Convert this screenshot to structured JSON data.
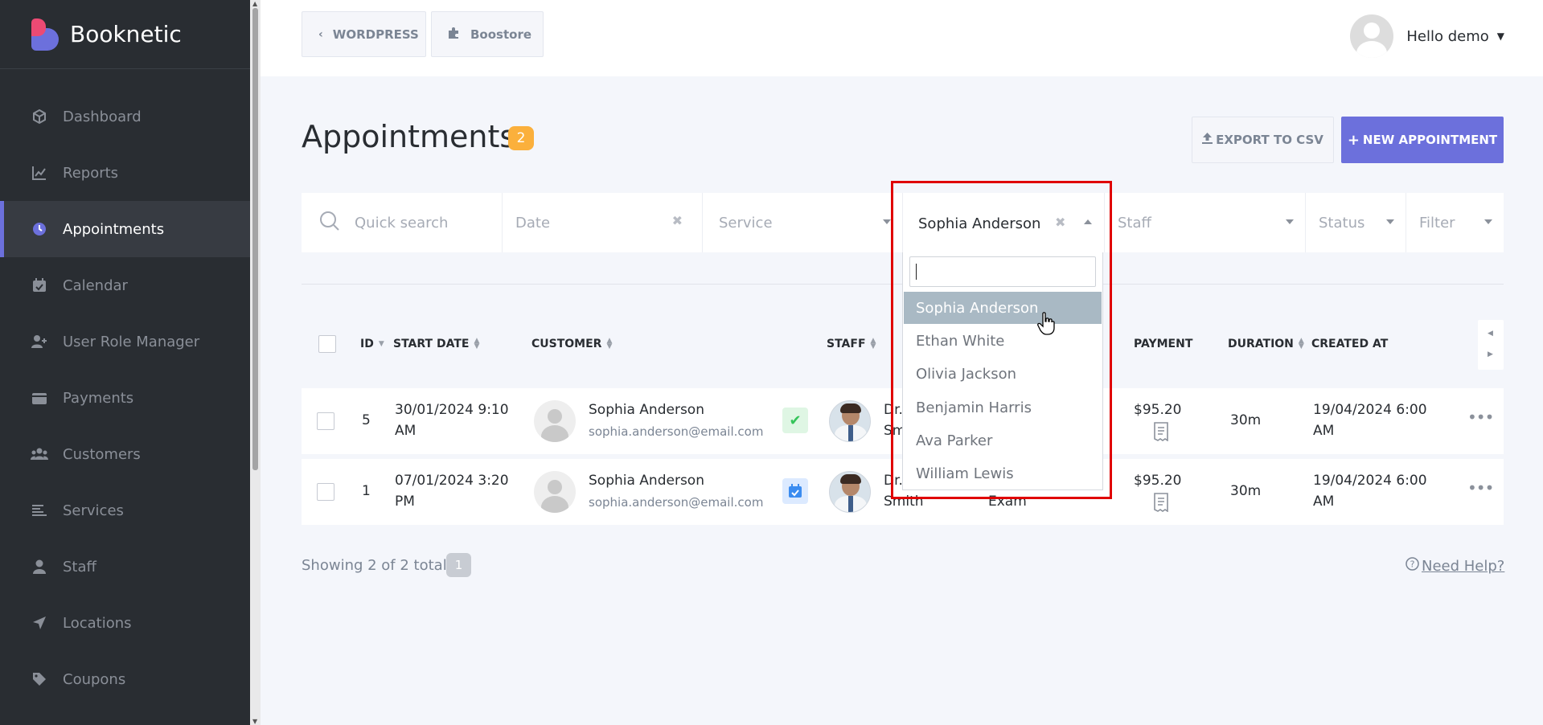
{
  "brand": {
    "name": "Booknetic"
  },
  "sidebar": {
    "items": [
      {
        "label": "Dashboard",
        "icon": "cube-icon"
      },
      {
        "label": "Reports",
        "icon": "chart-icon"
      },
      {
        "label": "Appointments",
        "icon": "clock-icon",
        "active": true
      },
      {
        "label": "Calendar",
        "icon": "calendar-icon"
      },
      {
        "label": "User Role Manager",
        "icon": "user-plus-icon"
      },
      {
        "label": "Payments",
        "icon": "wallet-icon"
      },
      {
        "label": "Customers",
        "icon": "users-icon"
      },
      {
        "label": "Services",
        "icon": "list-icon"
      },
      {
        "label": "Staff",
        "icon": "user-icon"
      },
      {
        "label": "Locations",
        "icon": "location-arrow-icon"
      },
      {
        "label": "Coupons",
        "icon": "tag-icon"
      }
    ]
  },
  "topbar": {
    "wordpress_label": "WORDPRESS",
    "boostore_label": "Boostore",
    "user_greeting": "Hello demo"
  },
  "page": {
    "title": "Appointments",
    "count": "2",
    "export_label": "EXPORT TO CSV",
    "new_label": "NEW APPOINTMENT"
  },
  "filters": {
    "search_placeholder": "Quick search",
    "date_placeholder": "Date",
    "service_placeholder": "Service",
    "customer_selected": "Sophia Anderson",
    "staff_placeholder": "Staff",
    "status_placeholder": "Status",
    "filter_placeholder": "Filter"
  },
  "dropdown": {
    "options": [
      "Sophia Anderson",
      "Ethan White",
      "Olivia Jackson",
      "Benjamin Harris",
      "Ava Parker",
      "William Lewis"
    ],
    "highlighted": "Sophia Anderson"
  },
  "table": {
    "headers": {
      "id": "ID",
      "start_date": "START DATE",
      "customer": "CUSTOMER",
      "staff": "STAFF",
      "payment": "PAYMENT",
      "duration": "DURATION",
      "created_at": "CREATED AT"
    },
    "rows": [
      {
        "id": "5",
        "start_line1": "30/01/2024 9:10",
        "start_line2": "AM",
        "customer_name": "Sophia Anderson",
        "customer_email": "sophia.anderson@email.com",
        "status": "approved",
        "staff_line1": "Dr.",
        "staff_line2": "Sm",
        "service_line2": "",
        "payment": "$95.20",
        "duration": "30m",
        "created_line1": "19/04/2024 6:00",
        "created_line2": "AM"
      },
      {
        "id": "1",
        "start_line1": "07/01/2024 3:20",
        "start_line2": "PM",
        "customer_name": "Sophia Anderson",
        "customer_email": "sophia.anderson@email.com",
        "status": "scheduled",
        "staff_line1": "Dr.",
        "staff_line2": "Smith",
        "service_line2": "Exam",
        "payment": "$95.20",
        "duration": "30m",
        "created_line1": "19/04/2024 6:00",
        "created_line2": "AM"
      }
    ]
  },
  "footer": {
    "showing": "Showing 2 of 2 total",
    "page": "1",
    "help": "Need Help?"
  },
  "colors": {
    "accent": "#6c70dc",
    "badge": "#fbb03c",
    "sidebar": "#292d32",
    "highlight_box": "#e00000"
  }
}
